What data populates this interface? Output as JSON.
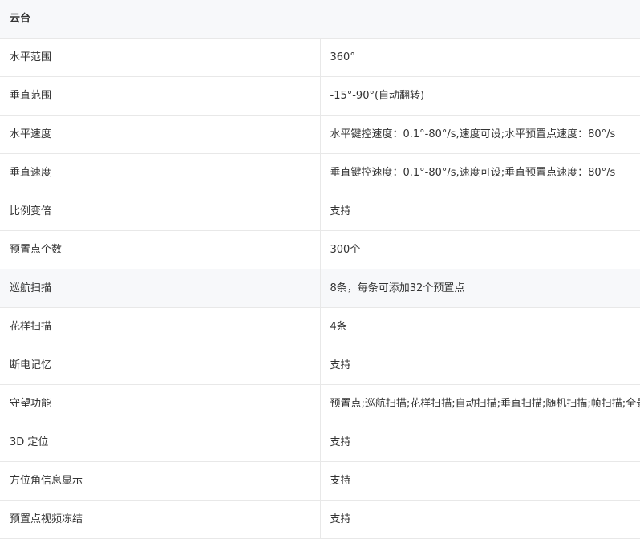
{
  "section": {
    "title": "云台"
  },
  "rows": [
    {
      "label": "水平范围",
      "value": "360°"
    },
    {
      "label": "垂直范围",
      "value": "-15°-90°(自动翻转)"
    },
    {
      "label": "水平速度",
      "value": "水平键控速度：0.1°-80°/s,速度可设;水平预置点速度：80°/s"
    },
    {
      "label": "垂直速度",
      "value": "垂直键控速度：0.1°-80°/s,速度可设;垂直预置点速度：80°/s"
    },
    {
      "label": "比例变倍",
      "value": "支持"
    },
    {
      "label": "预置点个数",
      "value": "300个"
    },
    {
      "label": "巡航扫描",
      "value": "8条，每条可添加32个预置点"
    },
    {
      "label": "花样扫描",
      "value": "4条"
    },
    {
      "label": "断电记忆",
      "value": "支持"
    },
    {
      "label": "守望功能",
      "value": "预置点;巡航扫描;花样扫描;自动扫描;垂直扫描;随机扫描;帧扫描;全景扫描"
    },
    {
      "label": "3D 定位",
      "value": "支持"
    },
    {
      "label": "方位角信息显示",
      "value": "支持"
    },
    {
      "label": "预置点视频冻结",
      "value": "支持"
    }
  ]
}
